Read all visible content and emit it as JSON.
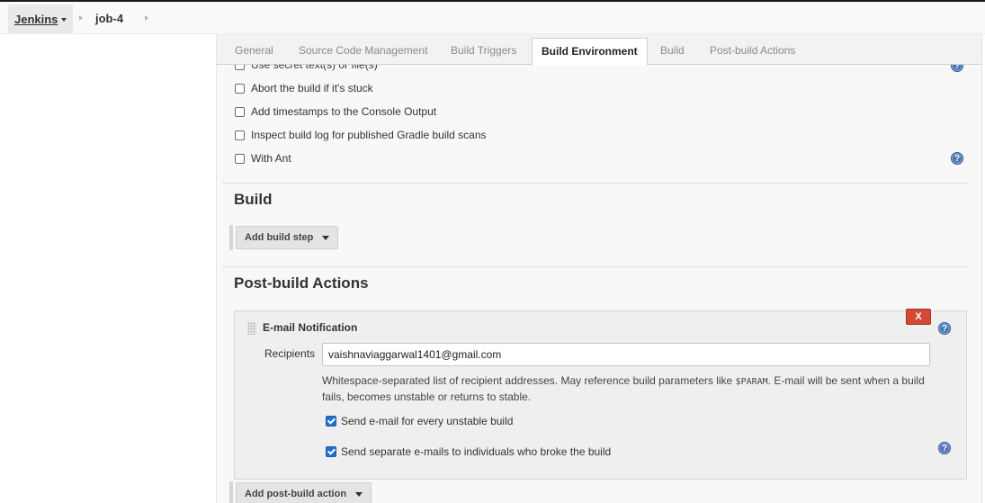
{
  "breadcrumb": {
    "root": "Jenkins",
    "job": "job-4"
  },
  "tabs": [
    {
      "label": "General",
      "active": false
    },
    {
      "label": "Source Code Management",
      "active": false
    },
    {
      "label": "Build Triggers",
      "active": false
    },
    {
      "label": "Build Environment",
      "active": true
    },
    {
      "label": "Build",
      "active": false
    },
    {
      "label": "Post-build Actions",
      "active": false
    }
  ],
  "build_environment": {
    "options": [
      {
        "label": "Use secret text(s) or file(s)",
        "checked": false
      },
      {
        "label": "Abort the build if it's stuck",
        "checked": false
      },
      {
        "label": "Add timestamps to the Console Output",
        "checked": false
      },
      {
        "label": "Inspect build log for published Gradle build scans",
        "checked": false
      },
      {
        "label": "With Ant",
        "checked": false
      }
    ]
  },
  "build": {
    "title": "Build",
    "add_step_label": "Add build step"
  },
  "post_build": {
    "title": "Post-build Actions",
    "email": {
      "title": "E-mail Notification",
      "delete_label": "X",
      "recipients_label": "Recipients",
      "recipients_value": "vaishnaviaggarwal1401@gmail.com",
      "help_part1": "Whitespace-separated list of recipient addresses. May reference build parameters like ",
      "help_code": "$PARAM",
      "help_part2": ". E-mail will be sent when a build fails, becomes unstable or returns to stable.",
      "option_unstable": "Send e-mail for every unstable build",
      "option_unstable_checked": true,
      "option_individuals": "Send separate e-mails to individuals who broke the build",
      "option_individuals_checked": true
    },
    "add_action_label": "Add post-build action"
  },
  "help_glyph": "?",
  "colors": {
    "help_icon": "#4a76b1",
    "delete_button": "#d24939",
    "checkbox_checked": "#1f6fd1"
  }
}
